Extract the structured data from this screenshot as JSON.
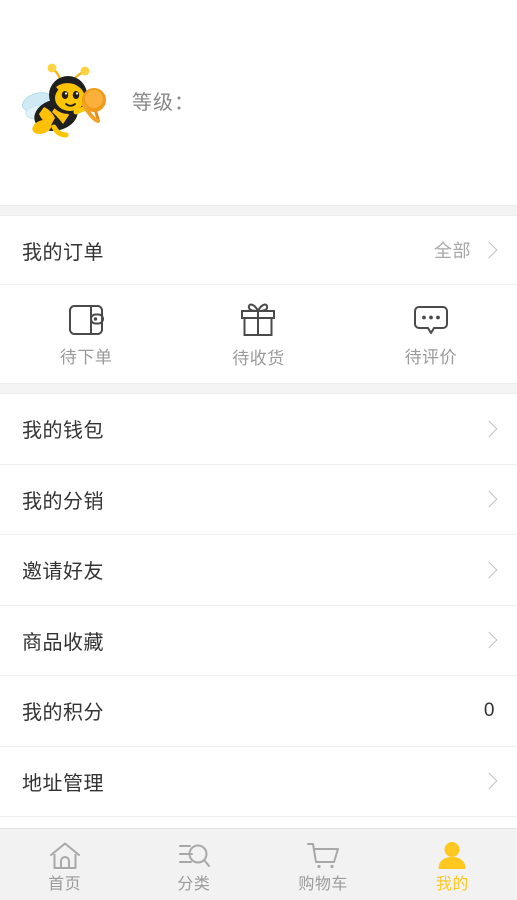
{
  "colors": {
    "accent": "#ffc820",
    "page_bg": "#f4f4f4",
    "card_bg": "#ffffff",
    "tabbar_bg": "#f2f2f2",
    "primary_text": "#333333",
    "muted_text": "#9a9a9a"
  },
  "profile": {
    "avatar_icon": "bee-mascot-icon",
    "level_label": "等级：",
    "level_value": ""
  },
  "orders": {
    "title": "我的订单",
    "all_label": "全部",
    "chevron_icon": "chevron-right-icon",
    "statuses": [
      {
        "label": "待下单",
        "icon": "wallet-icon"
      },
      {
        "label": "待收货",
        "icon": "gift-icon"
      },
      {
        "label": "待评价",
        "icon": "comment-icon"
      }
    ]
  },
  "menu": {
    "items": [
      {
        "label": "我的钱包",
        "value": "",
        "has_chevron": true
      },
      {
        "label": "我的分销",
        "value": "",
        "has_chevron": true
      },
      {
        "label": "邀请好友",
        "value": "",
        "has_chevron": true
      },
      {
        "label": "商品收藏",
        "value": "",
        "has_chevron": true
      },
      {
        "label": "我的积分",
        "value": "0",
        "has_chevron": false
      },
      {
        "label": "地址管理",
        "value": "",
        "has_chevron": true
      }
    ]
  },
  "tabbar": {
    "items": [
      {
        "label": "首页",
        "icon": "home-icon",
        "active": false
      },
      {
        "label": "分类",
        "icon": "category-search-icon",
        "active": false
      },
      {
        "label": "购物车",
        "icon": "shopping-cart-icon",
        "active": false
      },
      {
        "label": "我的",
        "icon": "user-icon",
        "active": true
      }
    ]
  }
}
